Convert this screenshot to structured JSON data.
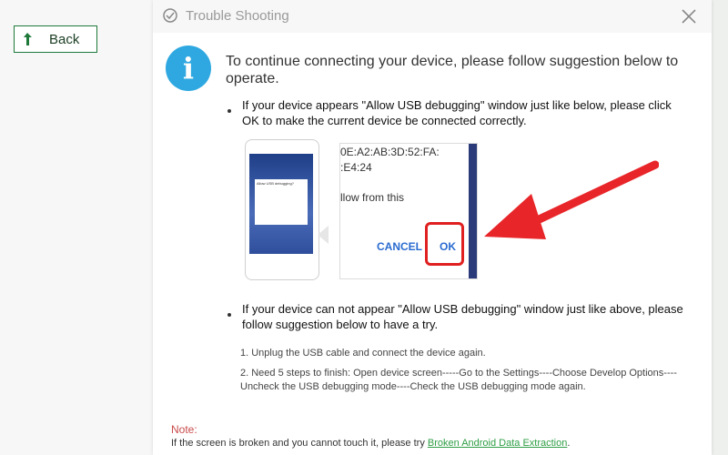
{
  "back_button": {
    "label": "Back"
  },
  "dialog": {
    "title": "Trouble Shooting",
    "heading": "To continue connecting your device, please follow suggestion below to operate.",
    "bullet1": "If your device appears \"Allow USB debugging\" window just like below, please click OK to make the current device  be connected correctly.",
    "screenshot": {
      "zoom_line1": "0E:A2:AB:3D:52:FA:",
      "zoom_line2": ":E4:24",
      "zoom_line3": "llow from this",
      "cancel_label": "CANCEL",
      "ok_label": "OK",
      "mini_title": "Allow USB debugging?"
    },
    "bullet2": "If your device can not appear \"Allow USB debugging\" window just like above, please follow suggestion below to have a try.",
    "step1": "1. Unplug the USB cable and connect the device again.",
    "step2": "2. Need 5 steps to finish: Open device screen-----Go to the Settings----Choose Develop Options----Uncheck the USB debugging mode----Check the USB debugging mode again.",
    "note_title": "Note:",
    "note_text": "If the screen is broken and you cannot touch it, please try ",
    "note_link": "Broken Android Data Extraction",
    "note_end": "."
  },
  "colors": {
    "accent": "#2fa8e1",
    "highlight": "#e02020",
    "link": "#2e9e44"
  }
}
